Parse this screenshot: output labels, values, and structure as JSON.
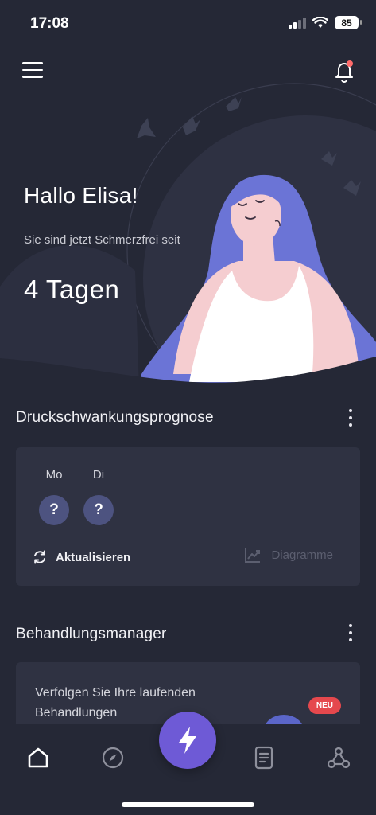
{
  "status_bar": {
    "time": "17:08",
    "battery": "85",
    "icons": [
      "signal-icon",
      "wifi-icon",
      "battery-icon"
    ]
  },
  "header": {
    "menu_icon": "hamburger-menu-icon",
    "bell_icon": "notification-bell-icon",
    "has_notification": true
  },
  "hero": {
    "greeting": "Hallo Elisa!",
    "subtitle": "Sie sind jetzt Schmerzfrei seit",
    "days": "4 Tagen"
  },
  "forecast": {
    "title": "Druckschwankungsprognose",
    "days": [
      {
        "label": "Mo",
        "value": "?"
      },
      {
        "label": "Di",
        "value": "?"
      }
    ],
    "refresh_label": "Aktualisieren",
    "charts_label": "Diagramme"
  },
  "manager": {
    "title": "Behandlungsmanager",
    "text": "Verfolgen Sie Ihre laufenden Behandlungen",
    "badge": "NEU"
  },
  "nav": {
    "items": [
      "home-icon",
      "compass-icon",
      "lightning-icon",
      "document-icon",
      "network-icon"
    ],
    "active": "home-icon"
  },
  "colors": {
    "background": "#252836",
    "card": "#2f3242",
    "accent": "#6e5ad6",
    "hair": "#6b74d6",
    "skin": "#f5cdd0",
    "badge": "#e5484d"
  }
}
